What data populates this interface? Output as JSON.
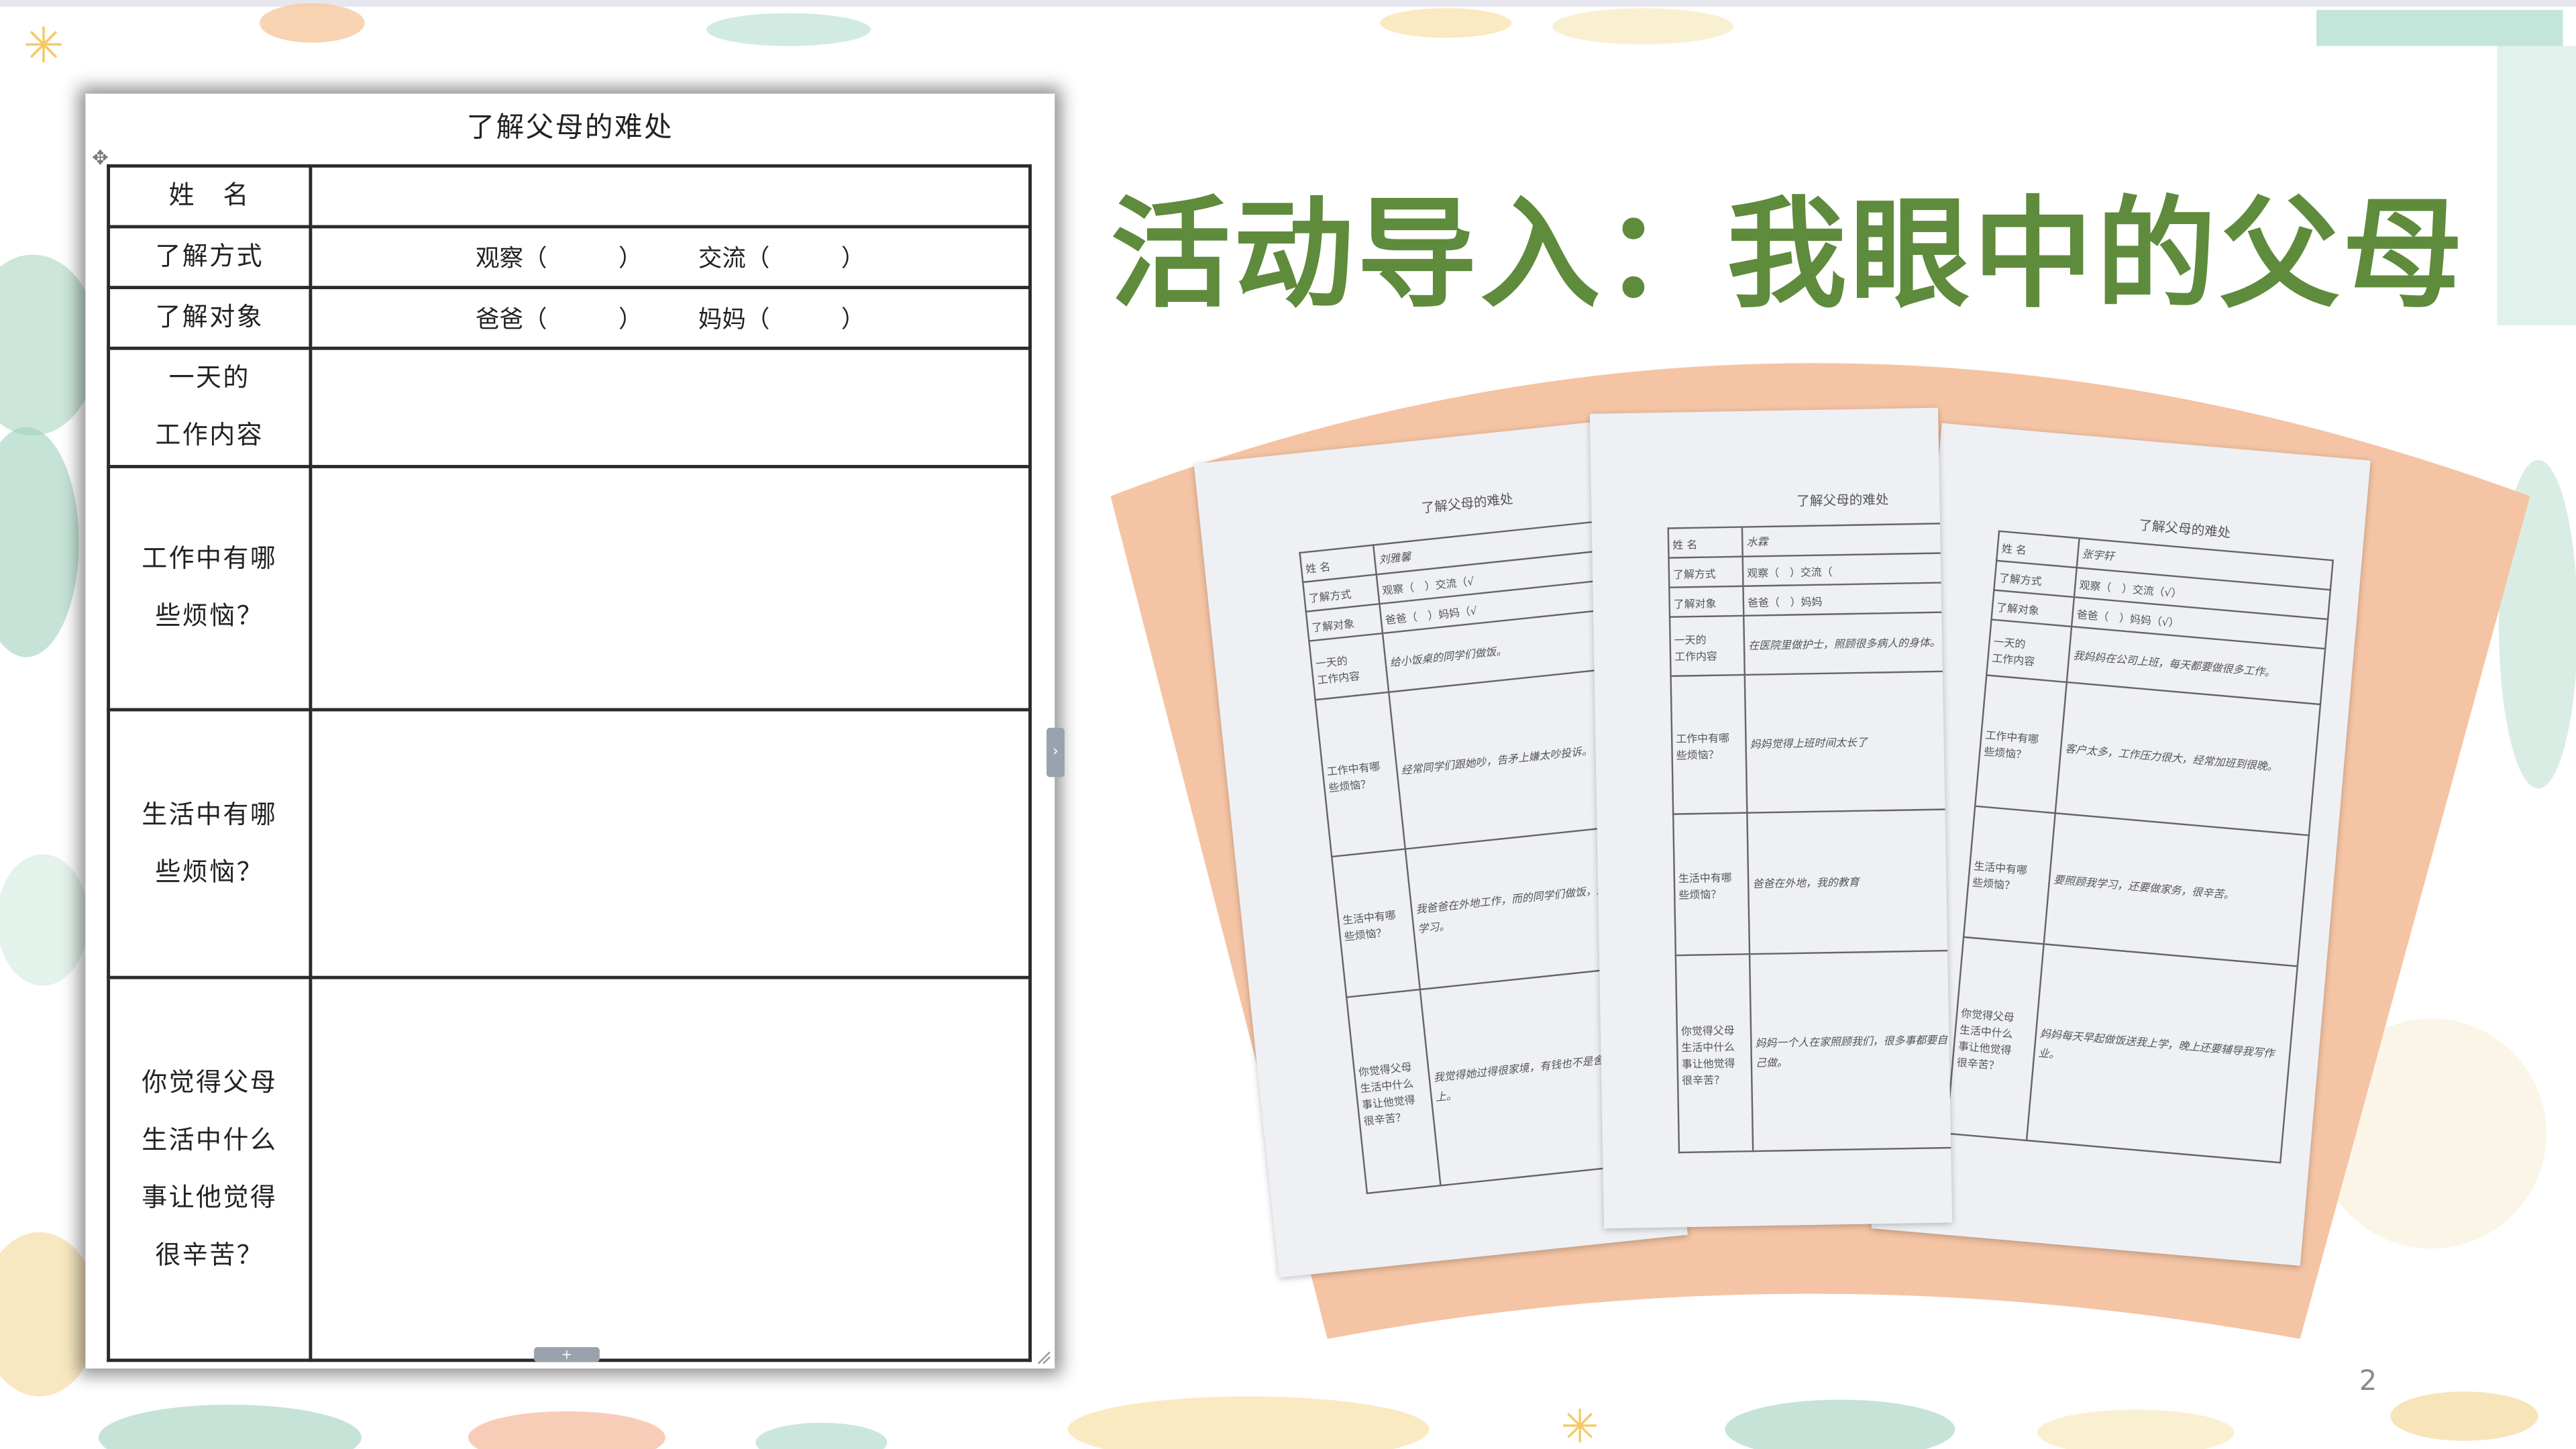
{
  "worksheet": {
    "title": "了解父母的难处",
    "rows": [
      {
        "label": "姓　名",
        "value": ""
      },
      {
        "label": "了解方式",
        "options": [
          "观察（　　　）",
          "交流（　　　）"
        ]
      },
      {
        "label": "了解对象",
        "options": [
          "爸爸（　　　）",
          "妈妈（　　　）"
        ]
      },
      {
        "label_lines": [
          "一天的",
          "工作内容"
        ],
        "value": ""
      },
      {
        "label_lines": [
          "工作中有哪",
          "些烦恼？"
        ],
        "value": ""
      },
      {
        "label_lines": [
          "生活中有哪",
          "些烦恼？"
        ],
        "value": ""
      },
      {
        "label_lines": [
          "你觉得父母",
          "生活中什么",
          "事让他觉得",
          "很辛苦？"
        ],
        "value": ""
      }
    ]
  },
  "slide": {
    "title": "活动导入：我眼中的父母",
    "page_number": "2"
  },
  "photos": [
    {
      "title": "了解父母的难处",
      "name": "刘雅馨",
      "labels": [
        "姓 名",
        "了解方式",
        "了解对象",
        "一天的",
        "工作内容",
        "工作中有哪",
        "些烦恼？",
        "生活中有哪",
        "些烦恼？",
        "你觉得父母",
        "生活中什么",
        "事让他觉得",
        "很辛苦？"
      ],
      "options_1": "观察（　）交流（√",
      "options_2": "爸爸（　）妈妈（√",
      "answers": [
        "给小饭桌的同学们做饭。",
        "经常同学们跟她吵，告矛上嫌太吵投诉。",
        "我爸爸在外地工作，而的同学们做饭，还要我的学习。",
        "我觉得她过得很家境，有钱也不是舍得吃舍得上。"
      ]
    },
    {
      "title": "了解父母的难处",
      "name": "水霖",
      "labels": [
        "姓 名",
        "了解方式",
        "了解对象",
        "一天的",
        "工作内容",
        "工作中有哪",
        "些烦恼？",
        "生活中有哪",
        "些烦恼？",
        "你觉得父母",
        "生活中什么",
        "事让他觉得",
        "很辛苦？"
      ],
      "options_1": "观察（　）交流（",
      "options_2": "爸爸（　）妈妈",
      "answers": [
        "在医院里做护士，照顾很多病人的身体。",
        "妈妈觉得上班时间太长了",
        "爸爸在外地，我的教育",
        "妈妈一个人在家照顾我们，很多事都要自己做。"
      ]
    },
    {
      "title": "了解父母的难处",
      "name": "张宇轩",
      "labels": [
        "姓 名",
        "了解方式",
        "了解对象",
        "一天的",
        "工作内容",
        "工作中有哪",
        "些烦恼？",
        "生活中有哪",
        "些烦恼？",
        "你觉得父母",
        "生活中什么",
        "事让他觉得",
        "很辛苦？"
      ],
      "options_1": "观察（　）交流（√）",
      "options_2": "爸爸（　）妈妈（√）",
      "answers": [
        "我妈妈在公司上班，每天都要做很多工作。",
        "客户太多，工作压力很大，经常加班到很晚。",
        "要照顾我学习，还要做家务，很辛苦。",
        "妈妈每天早起做饭送我上学，晚上还要辅导我写作业。"
      ]
    }
  ],
  "colors": {
    "title_green": "#5f8b3c",
    "fan_peach": "#f4c4a4",
    "handwriting_blue": "#5a63c9"
  }
}
